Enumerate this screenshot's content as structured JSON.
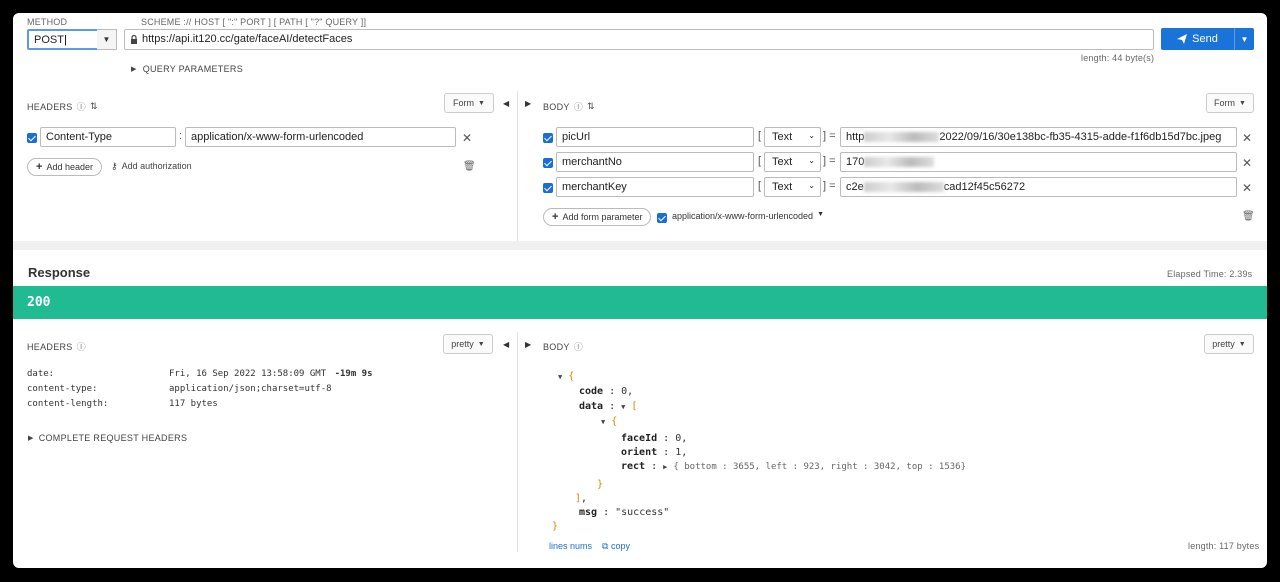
{
  "request": {
    "method_label": "METHOD",
    "scheme_hint": "SCHEME :// HOST [ \":\" PORT ] [ PATH [ \"?\" QUERY ]]",
    "method": "POST",
    "url": "https://api.it120.cc/gate/faceAI/detectFaces",
    "send_label": "Send",
    "length_info": "length: 44 byte(s)",
    "query_params_label": "QUERY PARAMETERS"
  },
  "req_headers": {
    "title": "HEADERS",
    "mode": "Form",
    "rows": [
      {
        "name": "Content-Type",
        "value": "application/x-www-form-urlencoded"
      }
    ],
    "add_header": "Add header",
    "add_auth": "Add authorization"
  },
  "req_body": {
    "title": "BODY",
    "mode": "Form",
    "rows": [
      {
        "name": "picUrl",
        "type": "Text",
        "value_prefix": "http",
        "value_suffix": "2022/09/16/30e138bc-fb35-4315-adde-f1f6db15d7bc.jpeg"
      },
      {
        "name": "merchantNo",
        "type": "Text",
        "value_prefix": "170",
        "value_suffix": ""
      },
      {
        "name": "merchantKey",
        "type": "Text",
        "value_prefix": "c2e",
        "value_suffix": "cad12f45c56272"
      }
    ],
    "add_param": "Add form parameter",
    "encoding": "application/x-www-form-urlencoded"
  },
  "response": {
    "title": "Response",
    "elapsed": "Elapsed Time: 2.39s",
    "status": "200",
    "headers_title": "HEADERS",
    "headers_mode": "pretty",
    "headers": [
      {
        "name": "date:",
        "value": "Fri, 16 Sep 2022 13:58:09 GMT",
        "extra": "-19m 9s"
      },
      {
        "name": "content-type:",
        "value": "application/json;charset=utf-8",
        "extra": ""
      },
      {
        "name": "content-length:",
        "value": "117 bytes",
        "extra": ""
      }
    ],
    "complete_headers": "COMPLETE REQUEST HEADERS",
    "body_title": "BODY",
    "body_mode": "pretty",
    "lines_nums": "lines nums",
    "copy": "copy",
    "length": "length: 117 bytes",
    "json": {
      "code_key": "code",
      "code_val": "0,",
      "data_key": "data",
      "faceId_key": "faceId",
      "faceId_val": "0,",
      "orient_key": "orient",
      "orient_val": "1,",
      "rect_key": "rect",
      "rect_summary": "{ bottom :  3655,  left :  923,  right :  3042,  top :  1536}",
      "msg_key": "msg",
      "msg_val": "\"success\""
    }
  }
}
